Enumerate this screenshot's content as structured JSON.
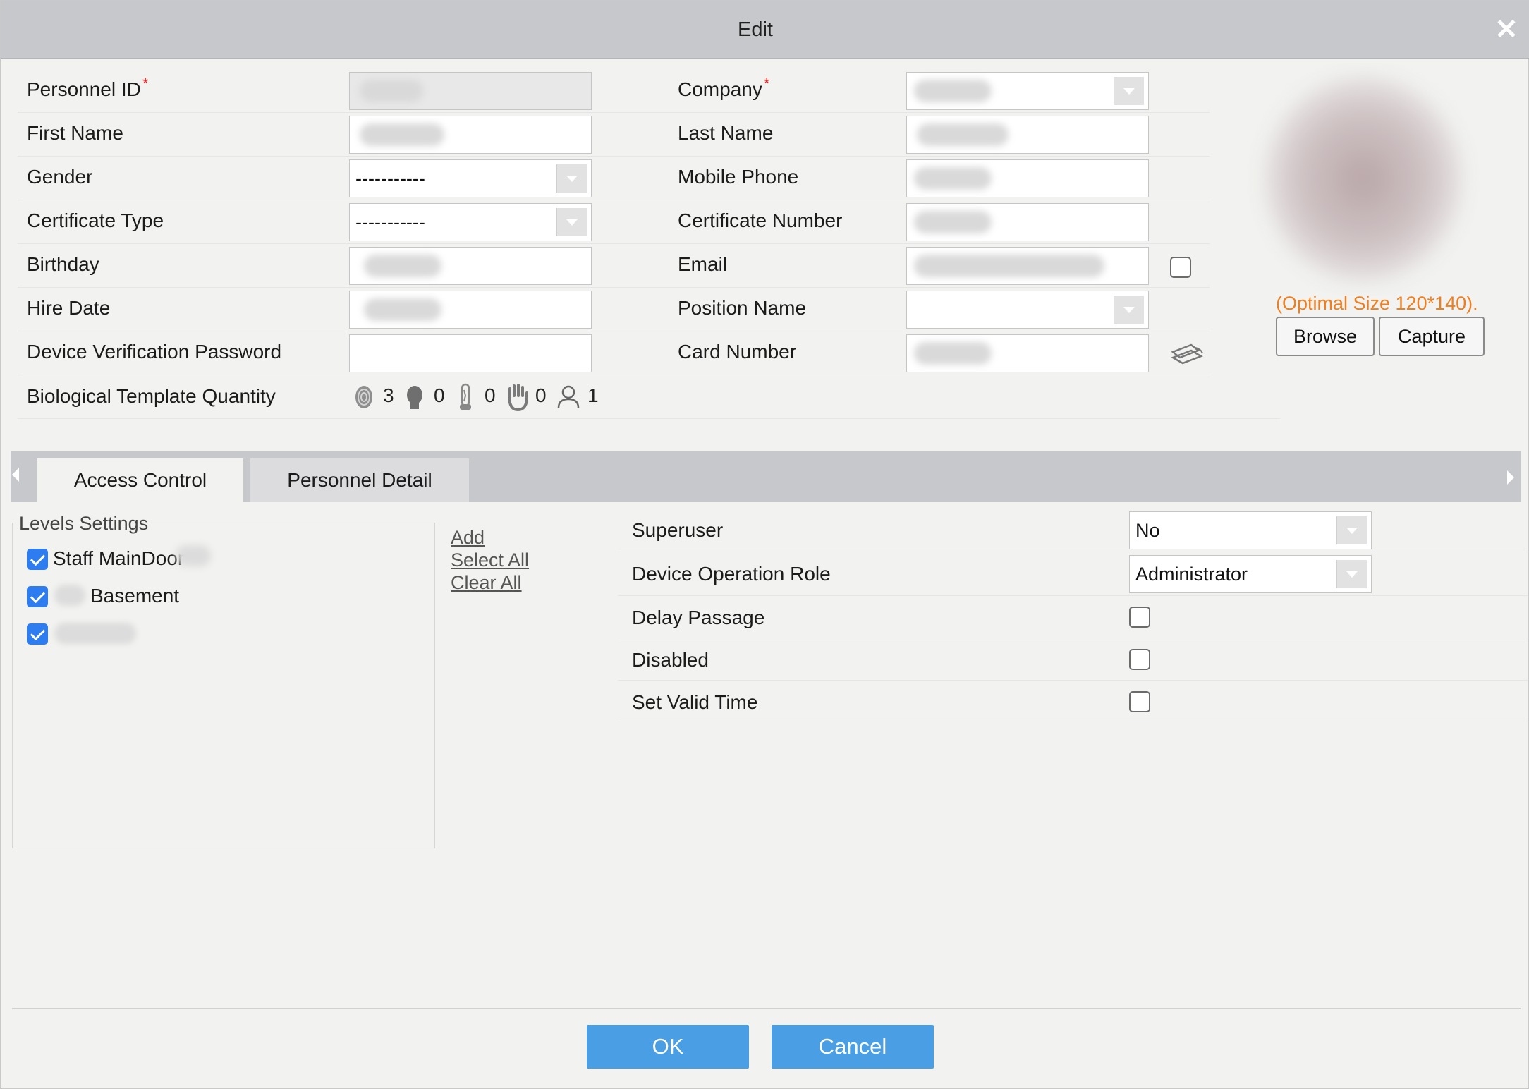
{
  "dialog": {
    "title": "Edit",
    "close_glyph": "✕"
  },
  "form": {
    "personnel_id": {
      "label": "Personnel ID",
      "required": "*"
    },
    "first_name": {
      "label": "First Name"
    },
    "gender": {
      "label": "Gender",
      "value": "-----------"
    },
    "certificate_type": {
      "label": "Certificate Type",
      "value": "-----------"
    },
    "birthday": {
      "label": "Birthday"
    },
    "hire_date": {
      "label": "Hire Date"
    },
    "device_verification_password": {
      "label": "Device Verification Password"
    },
    "biological_template_quantity": {
      "label": "Biological Template Quantity",
      "items": [
        {
          "icon": "fingerprint-icon",
          "count": "3"
        },
        {
          "icon": "face-icon",
          "count": "0"
        },
        {
          "icon": "finger-vein-icon",
          "count": "0"
        },
        {
          "icon": "palm-icon",
          "count": "0"
        },
        {
          "icon": "person-icon",
          "count": "1"
        }
      ]
    },
    "company": {
      "label": "Company",
      "required": "*"
    },
    "last_name": {
      "label": "Last Name"
    },
    "mobile_phone": {
      "label": "Mobile Phone"
    },
    "certificate_number": {
      "label": "Certificate Number"
    },
    "email": {
      "label": "Email"
    },
    "position_name": {
      "label": "Position Name"
    },
    "card_number": {
      "label": "Card Number"
    }
  },
  "photo": {
    "hint": "(Optimal Size 120*140).",
    "browse_label": "Browse",
    "capture_label": "Capture",
    "hint_color": "#f07d1e"
  },
  "tabs": [
    {
      "label": "Access Control",
      "active": true
    },
    {
      "label": "Personnel Detail",
      "active": false
    }
  ],
  "levels": {
    "legend": "Levels Settings",
    "items": [
      {
        "label": "Staff MainDoor",
        "checked": true
      },
      {
        "label": "Basement",
        "checked": true
      },
      {
        "label": "",
        "checked": true
      }
    ],
    "add_label": "Add",
    "select_all_label": "Select All",
    "clear_all_label": "Clear All"
  },
  "access": {
    "superuser": {
      "label": "Superuser",
      "value": "No"
    },
    "device_operation_role": {
      "label": "Device Operation Role",
      "value": "Administrator"
    },
    "delay_passage": {
      "label": "Delay Passage",
      "checked": false
    },
    "disabled": {
      "label": "Disabled",
      "checked": false
    },
    "set_valid_time": {
      "label": "Set Valid Time",
      "checked": false
    }
  },
  "footer": {
    "ok_label": "OK",
    "cancel_label": "Cancel"
  },
  "colors": {
    "accent": "#4a9ee3",
    "checkbox": "#2d7df0",
    "required": "#e02020"
  }
}
